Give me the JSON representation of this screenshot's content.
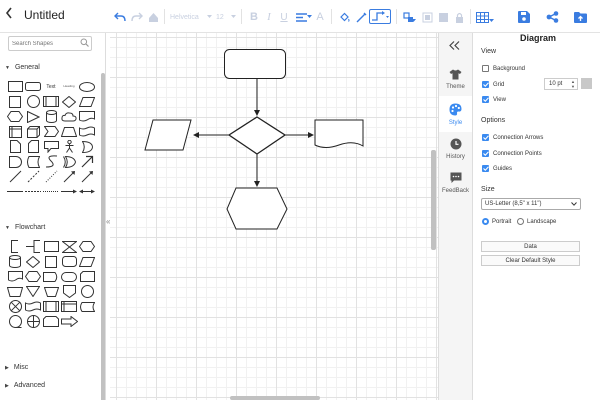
{
  "header": {
    "title": "Untitled",
    "font_family": "Helvetica",
    "font_size": "12"
  },
  "sidebar": {
    "search_placeholder": "Search Shapes",
    "categories": [
      "General",
      "Flowchart",
      "Misc",
      "Advanced"
    ],
    "text_shape_label": "Text",
    "heading_shape_label": "Heading"
  },
  "side_tabs": [
    "Theme",
    "Style",
    "History",
    "FeedBack"
  ],
  "panel": {
    "title": "Diagram",
    "view_heading": "View",
    "background_label": "Background",
    "grid_label": "Grid",
    "grid_size": "10 pt",
    "view_label": "View",
    "options_heading": "Options",
    "connection_arrows_label": "Connection Arrows",
    "connection_points_label": "Connection Points",
    "guides_label": "Guides",
    "size_heading": "Size",
    "paper_size": "US-Letter (8,5\" x 11\")",
    "portrait_label": "Portrait",
    "landscape_label": "Landscape",
    "data_button": "Data",
    "clear_style_button": "Clear Default Style",
    "checks": {
      "background": false,
      "grid": true,
      "view": true,
      "connection_arrows": true,
      "connection_points": true,
      "guides": true
    },
    "orientation": "portrait"
  },
  "colors": {
    "accent": "#3a8af0",
    "toolbar_icon": "#3a7ce0"
  }
}
